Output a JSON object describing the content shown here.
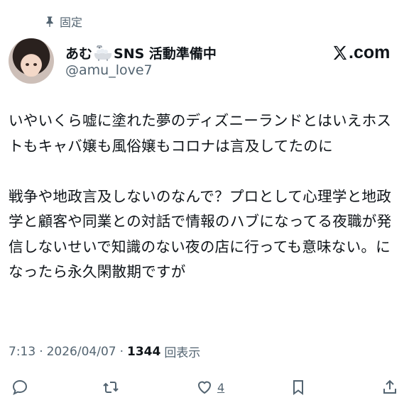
{
  "pinned": {
    "label": "固定",
    "icon": "pin-icon"
  },
  "author": {
    "display_name": "あむ",
    "display_name_suffix": "SNS 活動準備中",
    "emoji": "bathtub-icon",
    "handle": "@amu_love7"
  },
  "brand": {
    "logo_text": ".com",
    "icon": "x-logo-icon"
  },
  "tweet": {
    "paragraphs": [
      "いやいくら嘘に塗れた夢のディズニーランドとはいえホストもキャバ嬢も風俗嬢もコロナは言及してたのに",
      "戦争や地政言及しないのなんで？プロとして心理学と地政学と顧客や同業との対話で情報のハブになってる夜職が発信しないせいで知識のない夜の店に行っても意味ない。になったら永久閑散期ですが"
    ]
  },
  "meta": {
    "time": "7:13",
    "separator": "·",
    "date": "2026/04/07",
    "views_count": "1344",
    "views_label": "回表示"
  },
  "actions": {
    "reply": {
      "icon": "reply-icon"
    },
    "retweet": {
      "icon": "retweet-icon"
    },
    "like": {
      "icon": "heart-icon",
      "count": "4"
    },
    "bookmark": {
      "icon": "bookmark-icon"
    },
    "share": {
      "icon": "share-icon"
    }
  }
}
